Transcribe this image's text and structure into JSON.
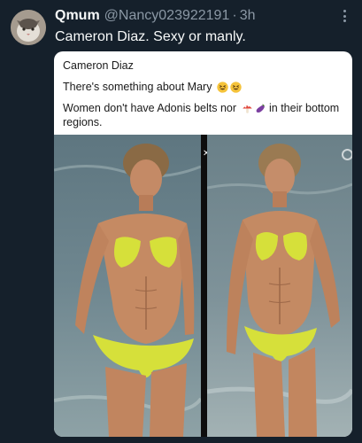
{
  "author": {
    "display_name": "Qmum",
    "handle": "@Nancy023922191",
    "separator": "·",
    "time": "3h"
  },
  "tweet": {
    "text": "Cameron Diaz. Sexy or manly."
  },
  "card": {
    "line1": "Cameron Diaz",
    "line2": "There's something about Mary",
    "line3_prefix": "Women don't have Adonis belts nor",
    "line3_suffix": "in their bottom regions.",
    "line2_emojis": [
      "grinning-squint-icon",
      "grinning-squint-icon"
    ],
    "line3_emojis": [
      "mushroom-icon",
      "eggplant-icon"
    ]
  },
  "colors": {
    "background": "#15202b",
    "text_primary": "#f7f9f9",
    "text_secondary": "#8b98a5",
    "bikini": "#d6e03a"
  },
  "icons": {
    "more": "more-vertical-icon",
    "close": "close-icon",
    "settings": "gear-icon"
  }
}
